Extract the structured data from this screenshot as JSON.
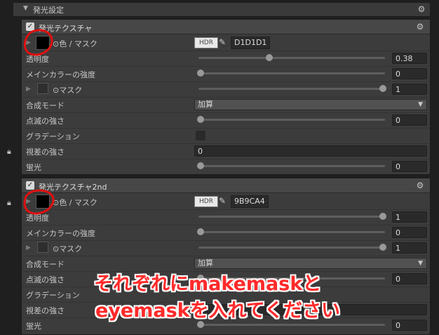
{
  "top_section": {
    "title": "発光設定"
  },
  "panel1": {
    "title": "発光テクスチャ",
    "color_label": "⊙色 / マスク",
    "hdr": "HDR",
    "hex": "D1D1D1",
    "rows": [
      {
        "label": "透明度",
        "value": "0.38",
        "slider": 0.38
      },
      {
        "label": "メインカラーの強度",
        "value": "0",
        "slider": 0.0
      },
      {
        "label": "⊙マスク",
        "value": "1",
        "slider": 1.0
      },
      {
        "label": "合成モード",
        "value": "加算"
      },
      {
        "label": "点滅の強さ",
        "value": "0",
        "slider": 0.0
      },
      {
        "label": "グラデーション"
      },
      {
        "label": "視差の強さ",
        "value": "0"
      },
      {
        "label": "蛍光",
        "value": "0",
        "slider": 0.0
      }
    ]
  },
  "panel2": {
    "title": "発光テクスチャ2nd",
    "color_label": "⊙色 / マスク",
    "hdr": "HDR",
    "hex": "9B9CA4",
    "rows": [
      {
        "label": "透明度",
        "value": "1",
        "slider": 1.0
      },
      {
        "label": "メインカラーの強度",
        "value": "0",
        "slider": 0.0
      },
      {
        "label": "⊙マスク",
        "value": "1",
        "slider": 1.0
      },
      {
        "label": "合成モード",
        "value": "加算"
      },
      {
        "label": "点滅の強さ",
        "value": "0",
        "slider": 0.0
      },
      {
        "label": "グラデーション"
      },
      {
        "label": "視差の強さ",
        "value": ""
      },
      {
        "label": "蛍光",
        "value": "0",
        "slider": 0.0
      }
    ]
  },
  "annotation": {
    "line1": "それぞれにmakemaskと",
    "line2": "eyemaskを入れてください",
    "color": "#ff2a2a"
  }
}
